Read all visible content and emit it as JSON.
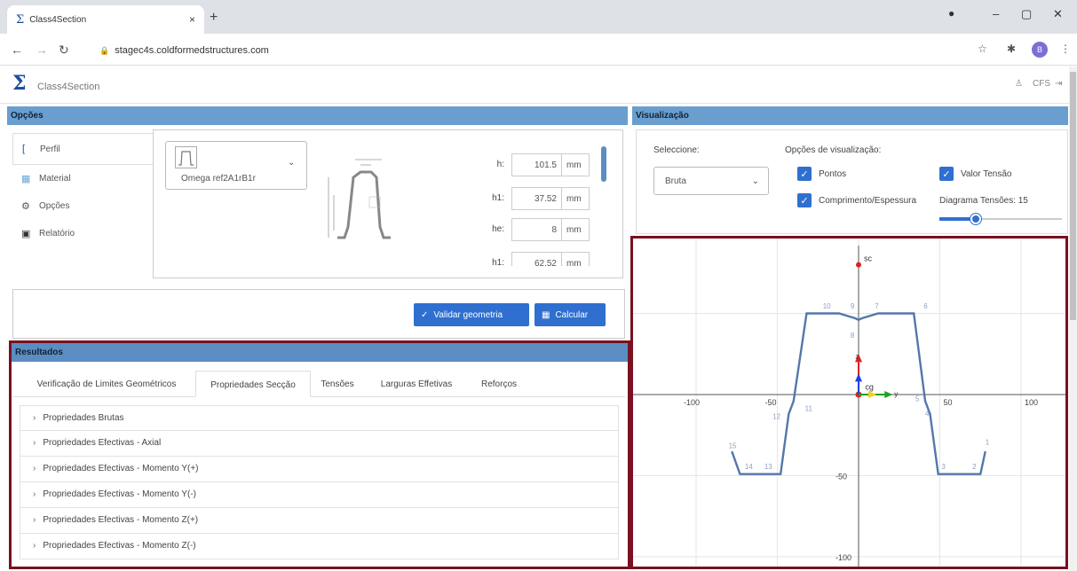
{
  "browser": {
    "tab_title": "Class4Section",
    "tab_close": "×",
    "new_tab": "+",
    "url": "stagec4s.coldformedstructures.com",
    "avatar_letter": "B",
    "win_min": "–",
    "win_max": "▢",
    "win_close": "✕"
  },
  "app": {
    "logo": "Σ",
    "name": "Class4Section",
    "header_right": [
      "CFS"
    ]
  },
  "options": {
    "header": "Opções",
    "nav": [
      {
        "label": "Perfil",
        "icon": "bracket-icon"
      },
      {
        "label": "Material",
        "icon": "grid-icon"
      },
      {
        "label": "Opções",
        "icon": "gear-icon"
      },
      {
        "label": "Relatório",
        "icon": "document-icon"
      }
    ],
    "profile_select": "Omega ref2A1rB1r",
    "params": [
      {
        "label": "h:",
        "value": "101.5",
        "unit": "mm"
      },
      {
        "label": "h1:",
        "value": "37.52",
        "unit": "mm"
      },
      {
        "label": "he:",
        "value": "8",
        "unit": "mm"
      },
      {
        "label": "h1:",
        "value": "62.52",
        "unit": "mm"
      }
    ],
    "validate_button": "Validar geometria",
    "calc_button": "Calcular"
  },
  "results": {
    "header": "Resultados",
    "tabs": [
      "Verificação de Limites Geométricos",
      "Propriedades Secção",
      "Tensões",
      "Larguras Effetivas",
      "Reforços"
    ],
    "active_tab": 1,
    "accordion": [
      "Propriedades Brutas",
      "Propriedades Efectivas - Axial",
      "Propriedades Efectivas - Momento Y(+)",
      "Propriedades Efectivas - Momento Y(-)",
      "Propriedades Efectivas - Momento Z(+)",
      "Propriedades Efectivas - Momento Z(-)"
    ]
  },
  "visualization": {
    "header": "Visualização",
    "select_label": "Seleccione:",
    "select_value": "Bruta",
    "options_label": "Opções de visualização:",
    "chk_points": "Pontos",
    "chk_length": "Comprimento/Espessura",
    "chk_stress": "Valor Tensão",
    "diagram_label": "Diagrama Tensões: 15",
    "slider_fraction": 0.3,
    "axis_ticks_x": [
      "-100",
      "-50",
      "50",
      "100"
    ],
    "axis_ticks_y": [
      "-50",
      "-100"
    ],
    "sc_label": "sc",
    "cg_label": "cg",
    "z_label": "z",
    "y_label": "y",
    "node_labels": [
      "1",
      "2",
      "3",
      "4",
      "5",
      "6",
      "7",
      "8",
      "9",
      "10",
      "11",
      "12",
      "13",
      "14",
      "15"
    ],
    "line_color": "#5577aa"
  }
}
